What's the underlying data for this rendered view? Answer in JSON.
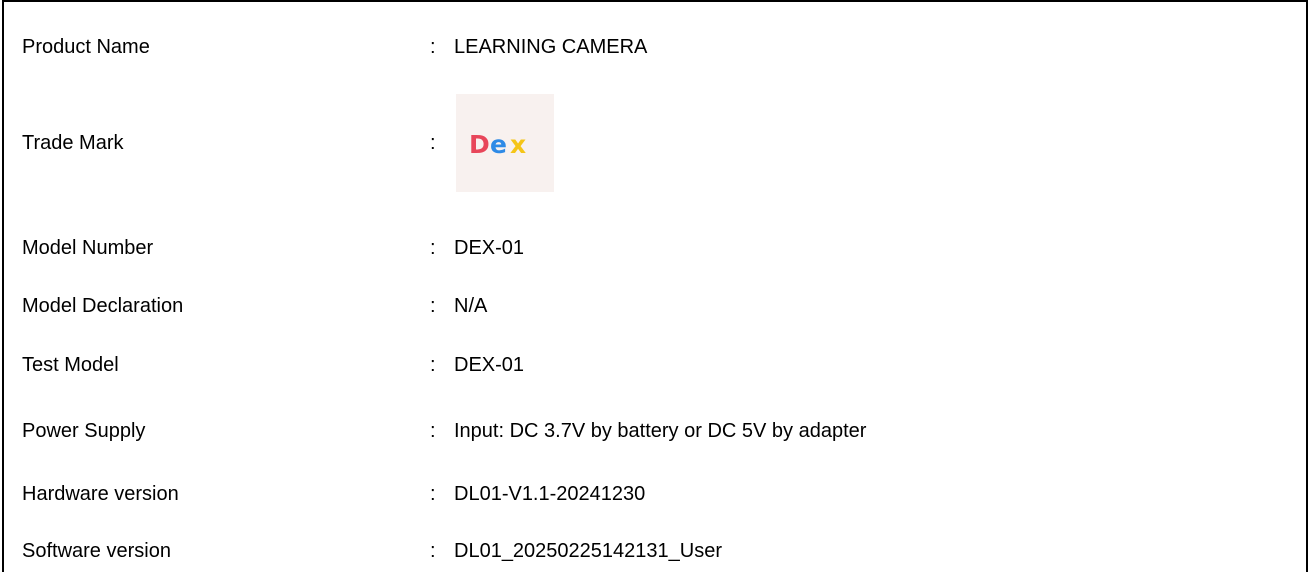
{
  "rows": [
    {
      "label": "Product Name",
      "value": "LEARNING CAMERA"
    },
    {
      "label": "Trade Mark",
      "value": "",
      "logo_text": "DEX"
    },
    {
      "label": "Model Number",
      "value": "DEX-01"
    },
    {
      "label": "Model Declaration",
      "value": "N/A"
    },
    {
      "label": "Test Model",
      "value": "DEX-01"
    },
    {
      "label": "Power Supply",
      "value": "Input: DC 3.7V by battery or DC 5V by adapter"
    },
    {
      "label": "Hardware version",
      "value": "DL01-V1.1-20241230"
    },
    {
      "label": "Software version",
      "value": "DL01_20250225142131_User"
    }
  ],
  "colon": ":",
  "logo_colors": {
    "d": "#e8465a",
    "e": "#2e8ae6",
    "x": "#f5c518",
    "background": "#f8f1ef"
  }
}
